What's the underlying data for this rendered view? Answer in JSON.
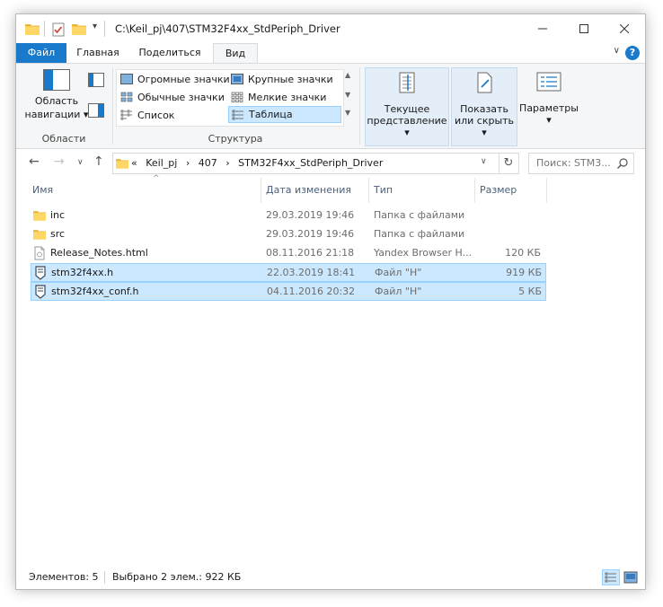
{
  "window": {
    "title": "C:\\Keil_pj\\407\\STM32F4xx_StdPeriph_Driver"
  },
  "tabs": [
    {
      "label": "Файл"
    },
    {
      "label": "Главная"
    },
    {
      "label": "Поделиться"
    },
    {
      "label": "Вид"
    }
  ],
  "ribbon": {
    "panes": {
      "label": "Области",
      "nav_pane_line1": "Область",
      "nav_pane_line2": "навигации ▾"
    },
    "layout": {
      "label": "Структура",
      "items": [
        {
          "label": "Огромные значки"
        },
        {
          "label": "Крупные значки"
        },
        {
          "label": "Обычные значки"
        },
        {
          "label": "Мелкие значки"
        },
        {
          "label": "Список"
        },
        {
          "label": "Таблица"
        }
      ]
    },
    "current_view": {
      "line1": "Текущее",
      "line2": "представление ▾"
    },
    "show_hide": {
      "line1": "Показать",
      "line2": "или скрыть ▾"
    },
    "options": {
      "line1": "Параметры",
      "line2": "▾"
    }
  },
  "address": {
    "crumbs": [
      "«",
      "Keil_pj",
      "›",
      "407",
      "›",
      "STM32F4xx_StdPeriph_Driver"
    ],
    "search_placeholder": "Поиск: STM3..."
  },
  "columns": {
    "name": "Имя",
    "date": "Дата изменения",
    "type": "Тип",
    "size": "Размер"
  },
  "files": [
    {
      "name": "inc",
      "date": "29.03.2019 19:46",
      "type": "Папка с файлами",
      "size": "",
      "icon": "folder-icon",
      "selected": false
    },
    {
      "name": "src",
      "date": "29.03.2019 19:46",
      "type": "Папка с файлами",
      "size": "",
      "icon": "folder-icon",
      "selected": false
    },
    {
      "name": "Release_Notes.html",
      "date": "08.11.2016 21:18",
      "type": "Yandex Browser H...",
      "size": "120 КБ",
      "icon": "html-file-icon",
      "selected": false
    },
    {
      "name": "stm32f4xx.h",
      "date": "22.03.2019 18:41",
      "type": "Файл \"H\"",
      "size": "919 КБ",
      "icon": "h-file-icon",
      "selected": true
    },
    {
      "name": "stm32f4xx_conf.h",
      "date": "04.11.2016 20:32",
      "type": "Файл \"H\"",
      "size": "5 КБ",
      "icon": "h-file-icon",
      "selected": true
    }
  ],
  "status": {
    "count": "Элементов: 5",
    "selection": "Выбрано 2 элем.: 922 КБ"
  },
  "colors": {
    "accent": "#1979ca",
    "selection": "#cce8ff",
    "folder": "#ffd766"
  }
}
